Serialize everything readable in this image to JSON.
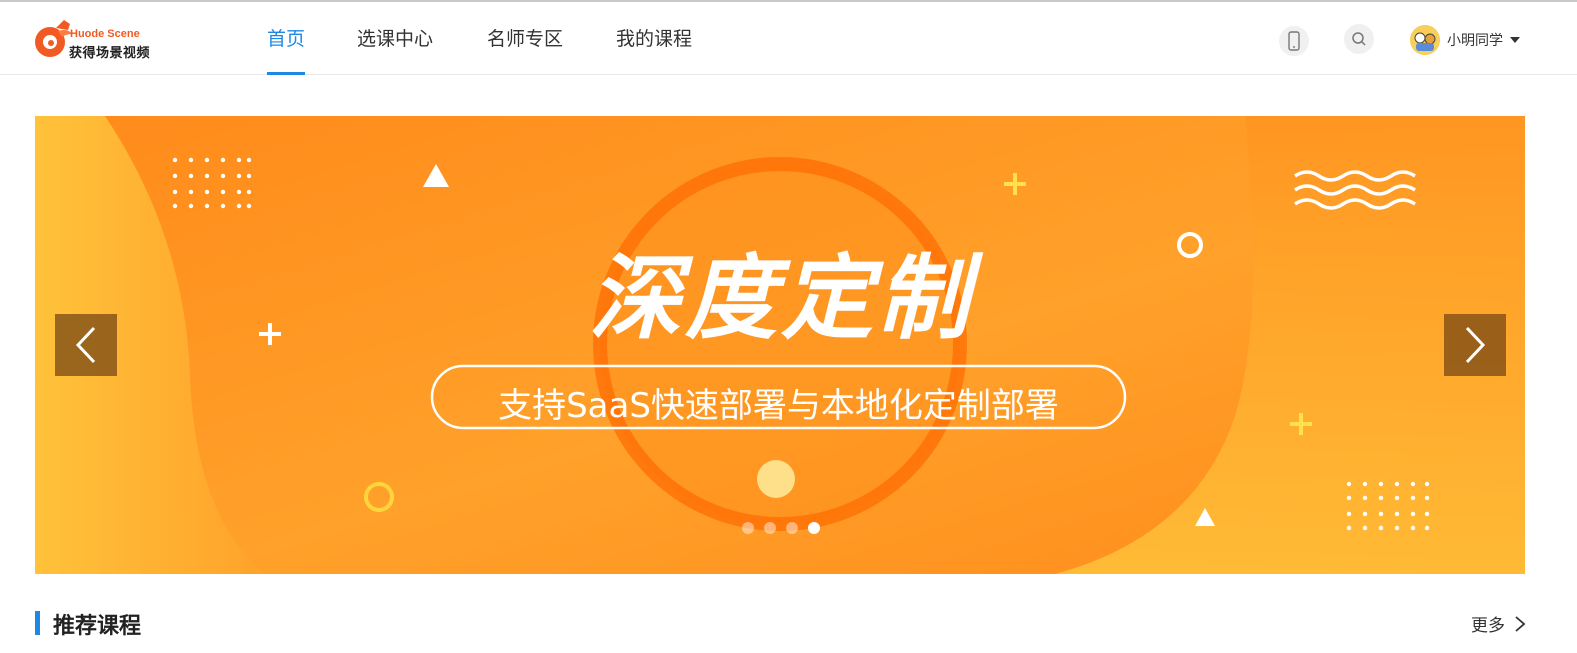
{
  "header": {
    "logo": {
      "en": "Huode Scene",
      "cn": "获得场景视频"
    },
    "nav": [
      {
        "label": "首页",
        "active": true
      },
      {
        "label": "选课中心",
        "active": false
      },
      {
        "label": "名师专区",
        "active": false
      },
      {
        "label": "我的课程",
        "active": false
      }
    ],
    "icons": [
      "mobile-icon",
      "search-icon"
    ],
    "user": {
      "name": "小明同学"
    }
  },
  "banner": {
    "title": "深度定制",
    "subtitle": "支持SaaS快速部署与本地化定制部署",
    "slides_total": 4,
    "active_slide": 4,
    "colors": {
      "base": "#ff9a1f",
      "accent": "#ffc83d",
      "ring": "#ff6a00"
    }
  },
  "section": {
    "title": "推荐课程",
    "more_label": "更多"
  },
  "colors": {
    "primary": "#1e88e5",
    "brand": "#f15a22"
  }
}
